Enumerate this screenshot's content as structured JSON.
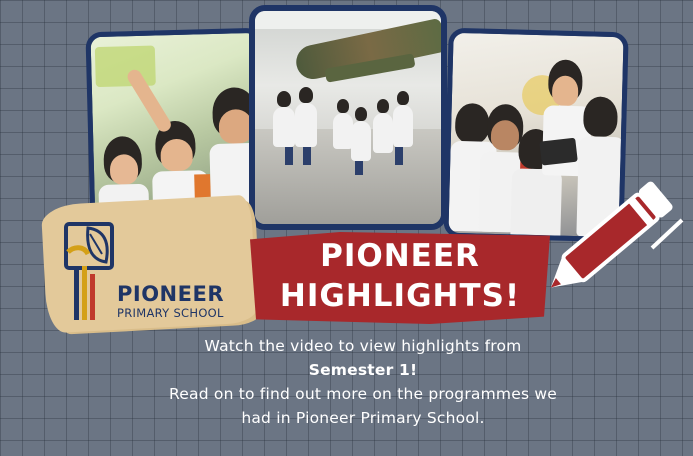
{
  "logo": {
    "name_line1": "PIONEER",
    "name_line2": "PRIMARY SCHOOL",
    "colors": {
      "navy": "#1f3566",
      "gold": "#d4a017",
      "red": "#c0392b"
    }
  },
  "banner": {
    "title_line1": "PIONEER",
    "title_line2": "HIGHLIGHTS!",
    "color": "#a8282b"
  },
  "caption": {
    "line1": "Watch the video to view highlights from",
    "line2": "Semester 1!",
    "line3": "Read on to find out more on the programmes we",
    "line4": "had in Pioneer Primary School."
  },
  "icons": [
    "pencil-icon",
    "leaf-logo-icon"
  ],
  "colors": {
    "background": "#6b7584",
    "frame": "#1f3566",
    "brush": "#e3c99a"
  }
}
